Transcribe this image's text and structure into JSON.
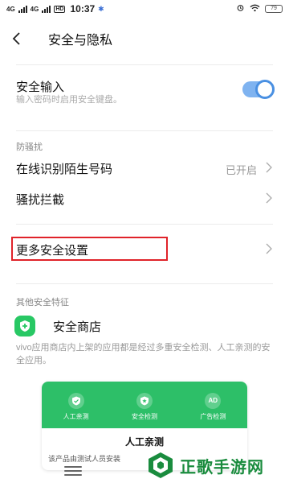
{
  "status_bar": {
    "sig1": "4G",
    "sig2": "4G",
    "hd": "HD",
    "time": "10:37",
    "battery": "79"
  },
  "header": {
    "title": "安全与隐私"
  },
  "secure_input": {
    "title": "安全输入",
    "subtitle": "输入密码时启用安全键盘。",
    "enabled": true
  },
  "sections": {
    "anti_harass_label": "防骚扰",
    "other_features_label": "其他安全特征"
  },
  "rows": {
    "stranger_id": {
      "label": "在线识别陌生号码",
      "value": "已开启"
    },
    "harass_block": {
      "label": "骚扰拦截"
    },
    "more_security": {
      "label": "更多安全设置"
    }
  },
  "store": {
    "title": "安全商店",
    "description": "vivo应用商店内上架的应用都是经过多重安全检测、人工亲测的安全应用。",
    "card": {
      "features": [
        {
          "label": "人工亲测",
          "icon": "check-shield-icon"
        },
        {
          "label": "安全检测",
          "icon": "star-shield-icon"
        },
        {
          "label": "广告检测",
          "icon": "ad-icon",
          "text": "AD"
        }
      ],
      "title": "人工亲测",
      "desc": "该产品由测试人员安装"
    }
  },
  "watermark": {
    "text": "正歌手游网"
  },
  "colors": {
    "accent_blue": "#4a90e2",
    "store_green": "#2dbf68",
    "highlight_red": "#e0232a",
    "watermark_green": "#1a8c3e"
  }
}
